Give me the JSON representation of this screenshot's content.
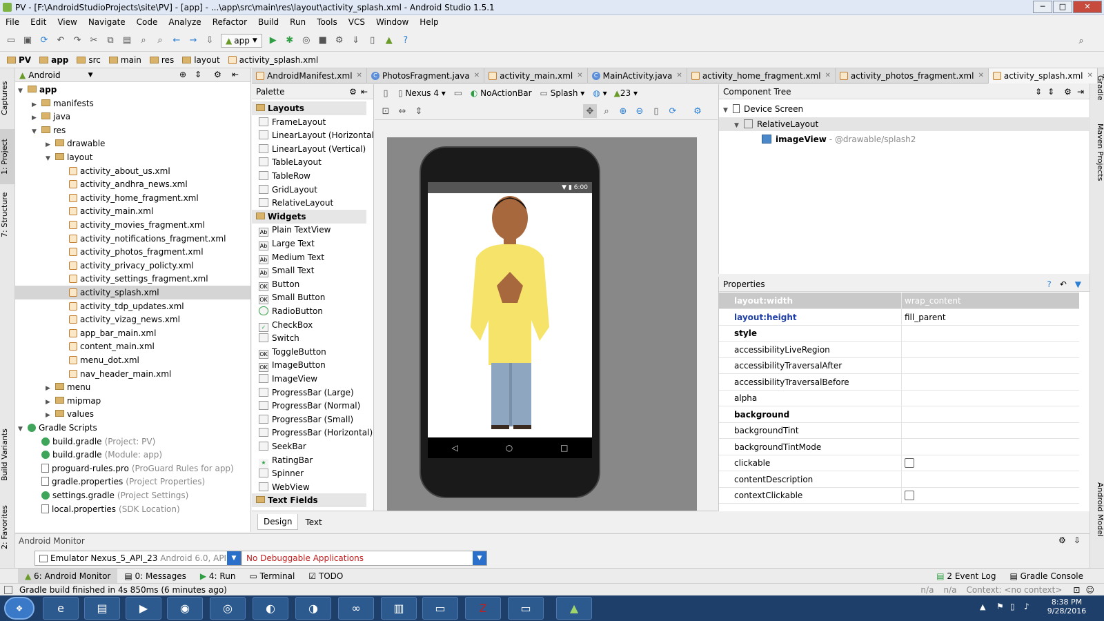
{
  "window": {
    "title": "PV - [F:\\AndroidStudioProjects\\site\\PV] - [app] - ...\\app\\src\\main\\res\\layout\\activity_splash.xml - Android Studio 1.5.1"
  },
  "menu": [
    "File",
    "Edit",
    "View",
    "Navigate",
    "Code",
    "Analyze",
    "Refactor",
    "Build",
    "Run",
    "Tools",
    "VCS",
    "Window",
    "Help"
  ],
  "toolbar": {
    "run_config": "app"
  },
  "breadcrumb": [
    "PV",
    "app",
    "src",
    "main",
    "res",
    "layout",
    "activity_splash.xml"
  ],
  "left_strip": [
    "Captures",
    "1: Project",
    "7: Structure",
    "Build Variants",
    "2: Favorites"
  ],
  "right_strip": [
    "Gradle",
    "Maven Projects",
    "Android Model"
  ],
  "project": {
    "view_mode": "Android",
    "items": [
      {
        "label": "app",
        "kind": "module"
      },
      {
        "label": "manifests",
        "kind": "folder"
      },
      {
        "label": "java",
        "kind": "folder"
      },
      {
        "label": "res",
        "kind": "folder"
      },
      {
        "label": "drawable",
        "kind": "folder"
      },
      {
        "label": "layout",
        "kind": "folder"
      },
      {
        "label": "activity_about_us.xml",
        "kind": "xml"
      },
      {
        "label": "activity_andhra_news.xml",
        "kind": "xml"
      },
      {
        "label": "activity_home_fragment.xml",
        "kind": "xml"
      },
      {
        "label": "activity_main.xml",
        "kind": "xml"
      },
      {
        "label": "activity_movies_fragment.xml",
        "kind": "xml"
      },
      {
        "label": "activity_notifications_fragment.xml",
        "kind": "xml"
      },
      {
        "label": "activity_photos_fragment.xml",
        "kind": "xml"
      },
      {
        "label": "activity_privacy_policty.xml",
        "kind": "xml"
      },
      {
        "label": "activity_settings_fragment.xml",
        "kind": "xml"
      },
      {
        "label": "activity_splash.xml",
        "kind": "xml"
      },
      {
        "label": "activity_tdp_updates.xml",
        "kind": "xml"
      },
      {
        "label": "activity_vizag_news.xml",
        "kind": "xml"
      },
      {
        "label": "app_bar_main.xml",
        "kind": "xml"
      },
      {
        "label": "content_main.xml",
        "kind": "xml"
      },
      {
        "label": "menu_dot.xml",
        "kind": "xml"
      },
      {
        "label": "nav_header_main.xml",
        "kind": "xml"
      },
      {
        "label": "menu",
        "kind": "folder"
      },
      {
        "label": "mipmap",
        "kind": "folder"
      },
      {
        "label": "values",
        "kind": "folder"
      },
      {
        "label": "Gradle Scripts",
        "kind": "gradle"
      },
      {
        "label": "build.gradle",
        "detail": "(Project: PV)",
        "kind": "gradle"
      },
      {
        "label": "build.gradle",
        "detail": "(Module: app)",
        "kind": "gradle"
      },
      {
        "label": "proguard-rules.pro",
        "detail": "(ProGuard Rules for app)",
        "kind": "file"
      },
      {
        "label": "gradle.properties",
        "detail": "(Project Properties)",
        "kind": "file"
      },
      {
        "label": "settings.gradle",
        "detail": "(Project Settings)",
        "kind": "gradle"
      },
      {
        "label": "local.properties",
        "detail": "(SDK Location)",
        "kind": "file"
      }
    ]
  },
  "editor_tabs": [
    "AndroidManifest.xml",
    "PhotosFragment.java",
    "activity_main.xml",
    "MainActivity.java",
    "activity_home_fragment.xml",
    "activity_photos_fragment.xml",
    "activity_splash.xml"
  ],
  "palette": {
    "title": "Palette",
    "layouts_label": "Layouts",
    "layouts": [
      "FrameLayout",
      "LinearLayout (Horizontal)",
      "LinearLayout (Vertical)",
      "TableLayout",
      "TableRow",
      "GridLayout",
      "RelativeLayout"
    ],
    "widgets_label": "Widgets",
    "widgets": [
      "Plain TextView",
      "Large Text",
      "Medium Text",
      "Small Text",
      "Button",
      "Small Button",
      "RadioButton",
      "CheckBox",
      "Switch",
      "ToggleButton",
      "ImageButton",
      "ImageView",
      "ProgressBar (Large)",
      "ProgressBar (Normal)",
      "ProgressBar (Small)",
      "ProgressBar (Horizontal)",
      "SeekBar",
      "RatingBar",
      "Spinner",
      "WebView"
    ],
    "text_fields_label": "Text Fields"
  },
  "design_toolbar": {
    "device": "Nexus 4",
    "theme": "NoActionBar",
    "activity": "Splash",
    "api": "23"
  },
  "phone": {
    "time": "6:00"
  },
  "design_tabs": [
    "Design",
    "Text"
  ],
  "component_tree": {
    "title": "Component Tree",
    "root": "Device Screen",
    "layout": "RelativeLayout",
    "child": "imageView",
    "child_detail": "- @drawable/splash2"
  },
  "properties": {
    "title": "Properties",
    "rows": [
      {
        "name": "layout:width",
        "value": "wrap_content"
      },
      {
        "name": "layout:height",
        "value": "fill_parent"
      },
      {
        "name": "style",
        "value": ""
      },
      {
        "name": "accessibilityLiveRegion",
        "value": ""
      },
      {
        "name": "accessibilityTraversalAfter",
        "value": ""
      },
      {
        "name": "accessibilityTraversalBefore",
        "value": ""
      },
      {
        "name": "alpha",
        "value": ""
      },
      {
        "name": "background",
        "value": ""
      },
      {
        "name": "backgroundTint",
        "value": ""
      },
      {
        "name": "backgroundTintMode",
        "value": ""
      },
      {
        "name": "clickable",
        "value": ""
      },
      {
        "name": "contentDescription",
        "value": ""
      },
      {
        "name": "contextClickable",
        "value": ""
      }
    ]
  },
  "monitor": {
    "title": "Android Monitor",
    "device": "Emulator Nexus_5_API_23",
    "device_detail": "Android 6.0, API 23",
    "app": "No Debuggable Applications"
  },
  "bottom_tabs": [
    "6: Android Monitor",
    "0: Messages",
    "4: Run",
    "Terminal",
    "TODO"
  ],
  "bottom_right_tabs": [
    "2 Event Log",
    "Gradle Console"
  ],
  "status": {
    "message": "Gradle build finished in 4s 850ms (6 minutes ago)",
    "na1": "n/a",
    "na2": "n/a",
    "context": "Context: <no context>"
  },
  "taskbar": {
    "time": "8:38 PM",
    "date": "9/28/2016"
  }
}
